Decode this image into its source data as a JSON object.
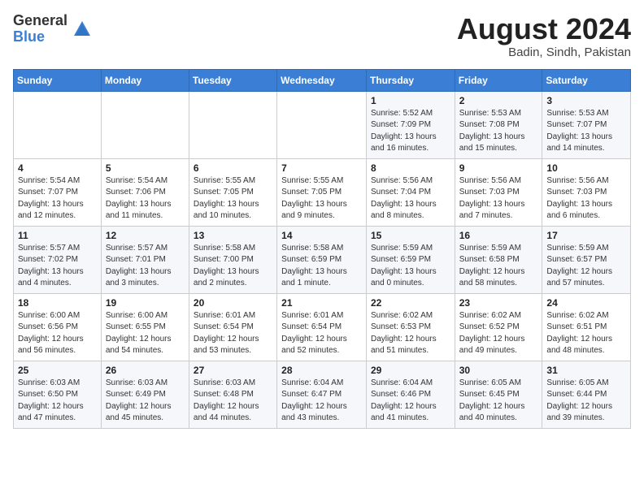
{
  "header": {
    "logo_general": "General",
    "logo_blue": "Blue",
    "month_year": "August 2024",
    "location": "Badin, Sindh, Pakistan"
  },
  "days_of_week": [
    "Sunday",
    "Monday",
    "Tuesday",
    "Wednesday",
    "Thursday",
    "Friday",
    "Saturday"
  ],
  "weeks": [
    [
      {
        "day": "",
        "info": ""
      },
      {
        "day": "",
        "info": ""
      },
      {
        "day": "",
        "info": ""
      },
      {
        "day": "",
        "info": ""
      },
      {
        "day": "1",
        "info": "Sunrise: 5:52 AM\nSunset: 7:09 PM\nDaylight: 13 hours\nand 16 minutes."
      },
      {
        "day": "2",
        "info": "Sunrise: 5:53 AM\nSunset: 7:08 PM\nDaylight: 13 hours\nand 15 minutes."
      },
      {
        "day": "3",
        "info": "Sunrise: 5:53 AM\nSunset: 7:07 PM\nDaylight: 13 hours\nand 14 minutes."
      }
    ],
    [
      {
        "day": "4",
        "info": "Sunrise: 5:54 AM\nSunset: 7:07 PM\nDaylight: 13 hours\nand 12 minutes."
      },
      {
        "day": "5",
        "info": "Sunrise: 5:54 AM\nSunset: 7:06 PM\nDaylight: 13 hours\nand 11 minutes."
      },
      {
        "day": "6",
        "info": "Sunrise: 5:55 AM\nSunset: 7:05 PM\nDaylight: 13 hours\nand 10 minutes."
      },
      {
        "day": "7",
        "info": "Sunrise: 5:55 AM\nSunset: 7:05 PM\nDaylight: 13 hours\nand 9 minutes."
      },
      {
        "day": "8",
        "info": "Sunrise: 5:56 AM\nSunset: 7:04 PM\nDaylight: 13 hours\nand 8 minutes."
      },
      {
        "day": "9",
        "info": "Sunrise: 5:56 AM\nSunset: 7:03 PM\nDaylight: 13 hours\nand 7 minutes."
      },
      {
        "day": "10",
        "info": "Sunrise: 5:56 AM\nSunset: 7:03 PM\nDaylight: 13 hours\nand 6 minutes."
      }
    ],
    [
      {
        "day": "11",
        "info": "Sunrise: 5:57 AM\nSunset: 7:02 PM\nDaylight: 13 hours\nand 4 minutes."
      },
      {
        "day": "12",
        "info": "Sunrise: 5:57 AM\nSunset: 7:01 PM\nDaylight: 13 hours\nand 3 minutes."
      },
      {
        "day": "13",
        "info": "Sunrise: 5:58 AM\nSunset: 7:00 PM\nDaylight: 13 hours\nand 2 minutes."
      },
      {
        "day": "14",
        "info": "Sunrise: 5:58 AM\nSunset: 6:59 PM\nDaylight: 13 hours\nand 1 minute."
      },
      {
        "day": "15",
        "info": "Sunrise: 5:59 AM\nSunset: 6:59 PM\nDaylight: 13 hours\nand 0 minutes."
      },
      {
        "day": "16",
        "info": "Sunrise: 5:59 AM\nSunset: 6:58 PM\nDaylight: 12 hours\nand 58 minutes."
      },
      {
        "day": "17",
        "info": "Sunrise: 5:59 AM\nSunset: 6:57 PM\nDaylight: 12 hours\nand 57 minutes."
      }
    ],
    [
      {
        "day": "18",
        "info": "Sunrise: 6:00 AM\nSunset: 6:56 PM\nDaylight: 12 hours\nand 56 minutes."
      },
      {
        "day": "19",
        "info": "Sunrise: 6:00 AM\nSunset: 6:55 PM\nDaylight: 12 hours\nand 54 minutes."
      },
      {
        "day": "20",
        "info": "Sunrise: 6:01 AM\nSunset: 6:54 PM\nDaylight: 12 hours\nand 53 minutes."
      },
      {
        "day": "21",
        "info": "Sunrise: 6:01 AM\nSunset: 6:54 PM\nDaylight: 12 hours\nand 52 minutes."
      },
      {
        "day": "22",
        "info": "Sunrise: 6:02 AM\nSunset: 6:53 PM\nDaylight: 12 hours\nand 51 minutes."
      },
      {
        "day": "23",
        "info": "Sunrise: 6:02 AM\nSunset: 6:52 PM\nDaylight: 12 hours\nand 49 minutes."
      },
      {
        "day": "24",
        "info": "Sunrise: 6:02 AM\nSunset: 6:51 PM\nDaylight: 12 hours\nand 48 minutes."
      }
    ],
    [
      {
        "day": "25",
        "info": "Sunrise: 6:03 AM\nSunset: 6:50 PM\nDaylight: 12 hours\nand 47 minutes."
      },
      {
        "day": "26",
        "info": "Sunrise: 6:03 AM\nSunset: 6:49 PM\nDaylight: 12 hours\nand 45 minutes."
      },
      {
        "day": "27",
        "info": "Sunrise: 6:03 AM\nSunset: 6:48 PM\nDaylight: 12 hours\nand 44 minutes."
      },
      {
        "day": "28",
        "info": "Sunrise: 6:04 AM\nSunset: 6:47 PM\nDaylight: 12 hours\nand 43 minutes."
      },
      {
        "day": "29",
        "info": "Sunrise: 6:04 AM\nSunset: 6:46 PM\nDaylight: 12 hours\nand 41 minutes."
      },
      {
        "day": "30",
        "info": "Sunrise: 6:05 AM\nSunset: 6:45 PM\nDaylight: 12 hours\nand 40 minutes."
      },
      {
        "day": "31",
        "info": "Sunrise: 6:05 AM\nSunset: 6:44 PM\nDaylight: 12 hours\nand 39 minutes."
      }
    ]
  ]
}
